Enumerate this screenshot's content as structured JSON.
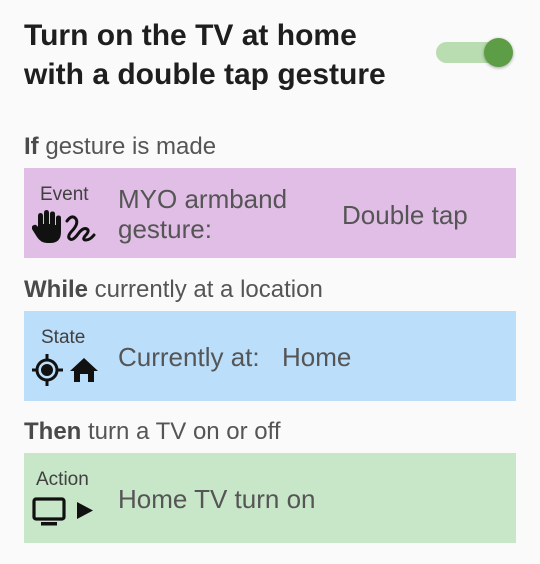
{
  "header": {
    "title": "Turn on the TV at home with a double tap gesture",
    "toggle_on": true
  },
  "trigger": {
    "keyword": "If",
    "rest": " gesture is made",
    "kind": "Event",
    "icons": [
      "hand-icon",
      "gesture-squiggle-icon"
    ],
    "subject": "MYO armband gesture:",
    "value": "Double tap",
    "color": "#e1bee6"
  },
  "condition": {
    "keyword": "While",
    "rest": " currently at a location",
    "kind": "State",
    "icons": [
      "location-target-icon",
      "home-icon"
    ],
    "subject": "Currently at:",
    "value": "Home",
    "color": "#bbdefa"
  },
  "action": {
    "keyword": "Then",
    "rest": " turn a TV on or off",
    "kind": "Action",
    "icons": [
      "tv-icon",
      "play-arrow-icon"
    ],
    "subject": "Home TV turn on",
    "color": "#c8e6c8"
  },
  "colors": {
    "toggle_track": "#b9dcb0",
    "toggle_thumb": "#5c9d45"
  }
}
